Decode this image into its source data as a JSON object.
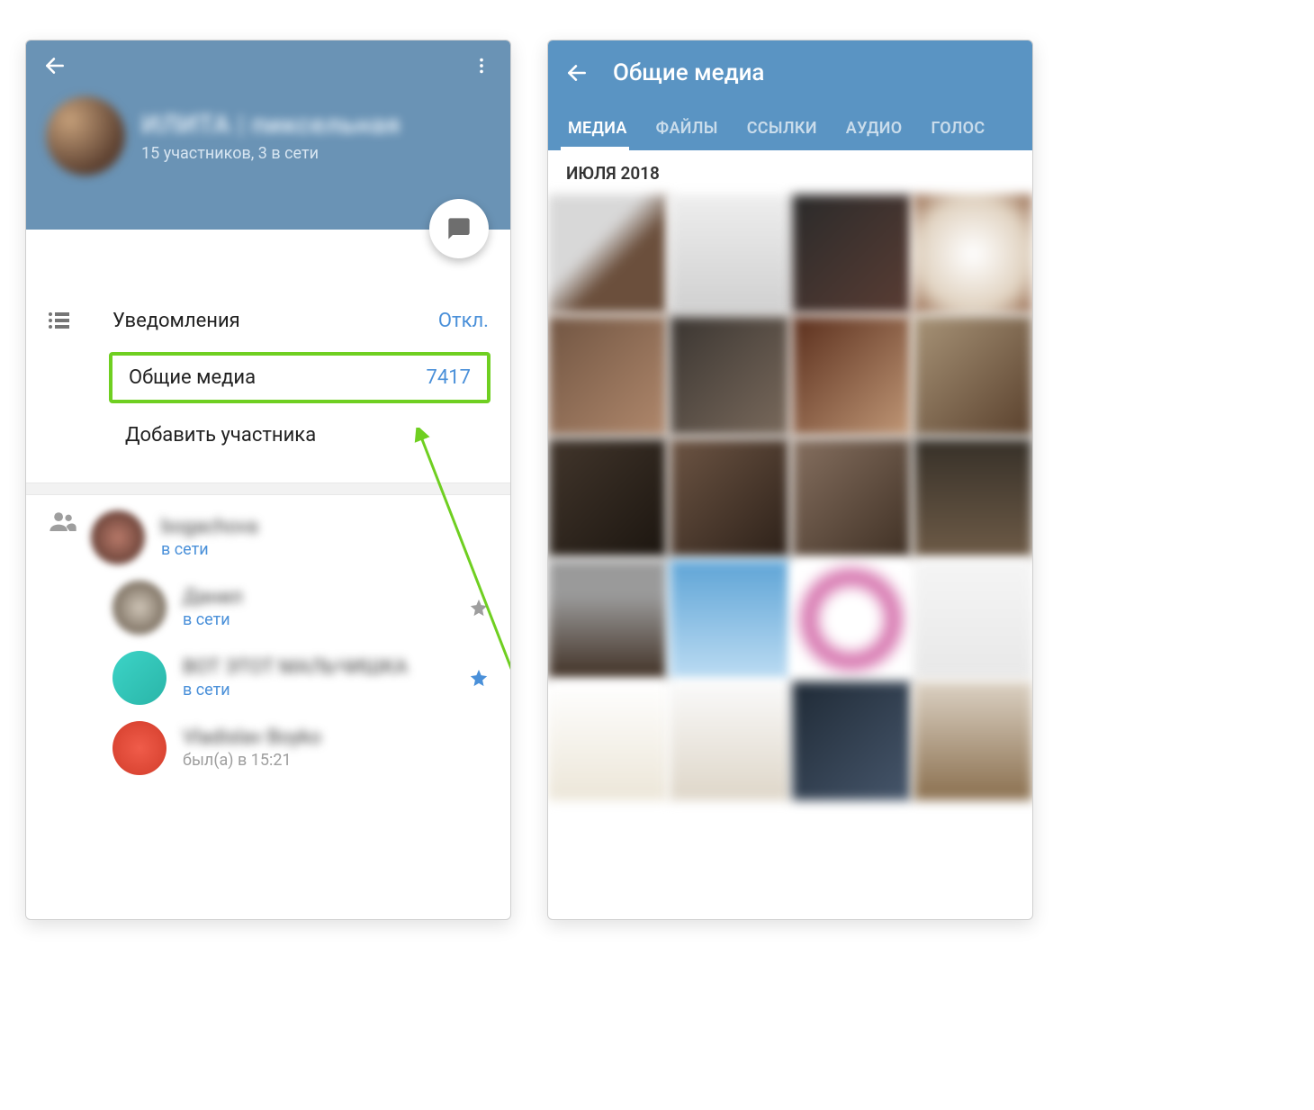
{
  "left": {
    "chat_title": "ИЛИТА | пиксельная",
    "chat_subtitle": "15 участников, 3 в сети",
    "notifications": {
      "label": "Уведомления",
      "value": "Откл."
    },
    "shared_media": {
      "label": "Общие медиа",
      "count": "7417"
    },
    "add_member": "Добавить участника",
    "members": [
      {
        "name": "bogachova",
        "status": "в сети",
        "star": false,
        "avatar_class": "m-a1"
      },
      {
        "name": "Данил",
        "status": "в сети",
        "star": "gray",
        "avatar_class": "m-a2"
      },
      {
        "name": "ВОТ ЭТОТ МАЛЬЧИШКА",
        "status": "в сети",
        "star": "blue",
        "avatar_class": "m-a3"
      },
      {
        "name": "Vladislav Boyko",
        "status": "был(а) в 15:21",
        "star": false,
        "avatar_class": "m-a4"
      }
    ]
  },
  "right": {
    "title": "Общие медиа",
    "tabs": [
      "МЕДИА",
      "ФАЙЛЫ",
      "ССЫЛКИ",
      "АУДИО",
      "ГОЛОС"
    ],
    "active_tab": 0,
    "date_header": "ИЮЛЯ 2018"
  }
}
